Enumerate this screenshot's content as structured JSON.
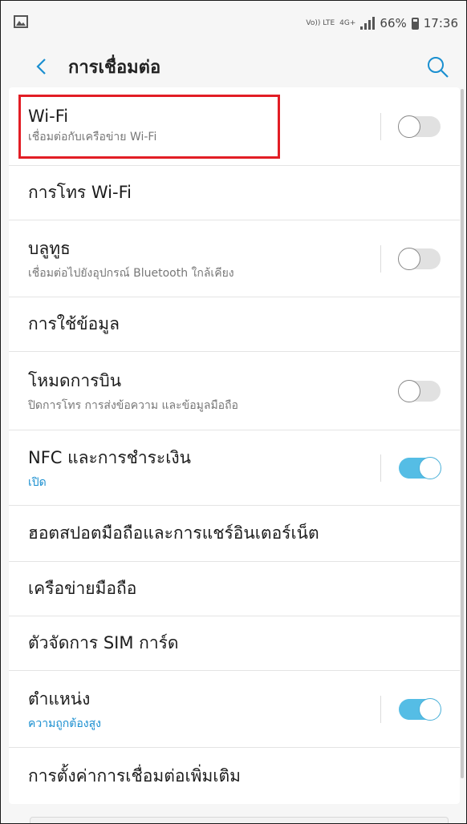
{
  "status": {
    "volte": "Vo)) LTE",
    "network": "4G+",
    "battery_percent": "66%",
    "time": "17:36",
    "battery_level": 0.66
  },
  "appbar": {
    "title": "การเชื่อมต่อ"
  },
  "items": [
    {
      "title": "Wi-Fi",
      "subtitle": "เชื่อมต่อกับเครือข่าย Wi-Fi",
      "toggle": "off"
    },
    {
      "title": "การโทร Wi-Fi"
    },
    {
      "title": "บลูทูธ",
      "subtitle": "เชื่อมต่อไปยังอุปกรณ์ Bluetooth ใกล้เคียง",
      "toggle": "off"
    },
    {
      "title": "การใช้ข้อมูล"
    },
    {
      "title": "โหมดการบิน",
      "subtitle": "ปิดการโทร การส่งข้อความ และข้อมูลมือถือ",
      "toggle": "off"
    },
    {
      "title": "NFC และการชำระเงิน",
      "subtitle": "เปิด",
      "toggle": "on"
    },
    {
      "title": "ฮอตสปอตมือถือและการแชร์อินเตอร์เน็ต"
    },
    {
      "title": "เครือข่ายมือถือ"
    },
    {
      "title": "ตัวจัดการ SIM การ์ด"
    },
    {
      "title": "ตำแหน่ง",
      "subtitle": "ความถูกต้องสูง",
      "toggle": "on"
    },
    {
      "title": "การตั้งค่าการเชื่อมต่อเพิ่มเติม"
    }
  ],
  "colors": {
    "accent": "#1a8fd0",
    "toggle_on": "#55bde5",
    "highlight": "#e21d25"
  }
}
